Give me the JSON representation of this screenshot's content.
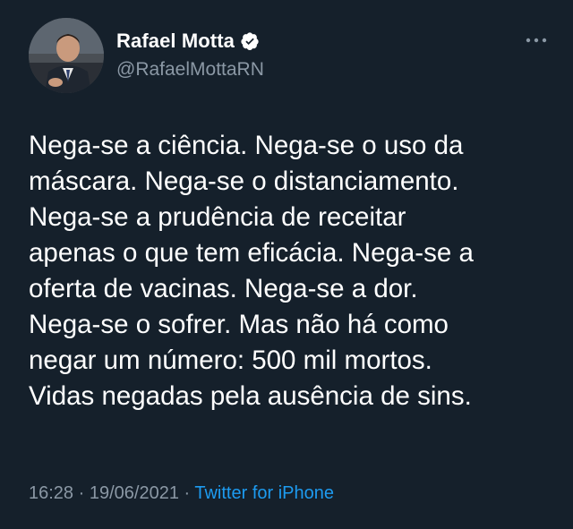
{
  "author": {
    "display_name": "Rafael Motta",
    "handle": "@RafaelMottaRN"
  },
  "icons": {
    "verified": "verified-badge-icon",
    "more": "more-options-icon",
    "avatar": "avatar"
  },
  "tweet": {
    "text": "Nega-se a ciência. Nega-se o uso da\nmáscara. Nega-se o distanciamento.\nNega-se a prudência de receitar\napenas o que tem eficácia. Nega-se a\noferta de vacinas. Nega-se a dor.\nNega-se o sofrer. Mas não há como\nnegar um número: 500 mil mortos.\nVidas negadas pela ausência de sins.",
    "time": "16:28",
    "date": "19/06/2021",
    "separator": " · ",
    "source": "Twitter for iPhone"
  },
  "colors": {
    "background": "#15202b",
    "text_primary": "#ffffff",
    "text_secondary": "#8b98a5",
    "accent": "#1d9bf0"
  }
}
